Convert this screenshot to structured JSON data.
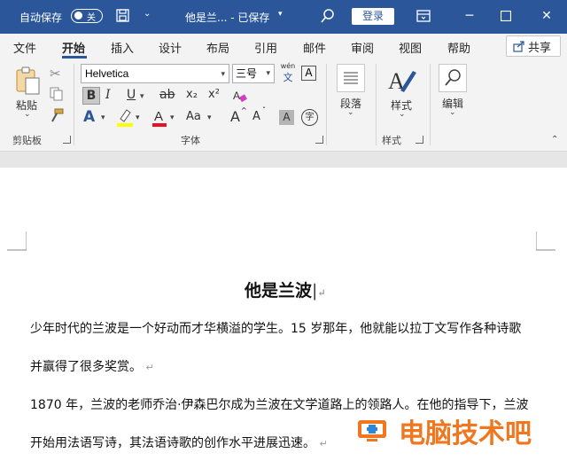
{
  "titlebar": {
    "autosave_label": "自动保存",
    "autosave_state": "关",
    "document_title": "他是兰... - 已保存",
    "login_label": "登录",
    "window_controls": [
      "minimize-icon",
      "restore-icon",
      "close-icon"
    ]
  },
  "tabs": [
    {
      "label": "文件"
    },
    {
      "label": "开始",
      "active": true
    },
    {
      "label": "插入"
    },
    {
      "label": "设计"
    },
    {
      "label": "布局"
    },
    {
      "label": "引用"
    },
    {
      "label": "邮件"
    },
    {
      "label": "审阅"
    },
    {
      "label": "视图"
    },
    {
      "label": "帮助"
    }
  ],
  "share_label": "共享",
  "ribbon": {
    "clipboard": {
      "paste_label": "粘贴",
      "group_label": "剪贴板"
    },
    "font": {
      "font_name": "Helvetica",
      "font_size": "三号",
      "phonetic_top": "wén",
      "phonetic_bottom": "文",
      "bold": "B",
      "italic": "I",
      "underline": "U",
      "strike": "ab",
      "subscript": "x₂",
      "superscript": "x²",
      "grow": "A",
      "shrink": "A",
      "case": "Aa",
      "shade": "A",
      "enclose": "字",
      "group_label": "字体"
    },
    "paragraph": {
      "label": "段落"
    },
    "styles": {
      "label": "样式",
      "group_label": "样式"
    },
    "editing": {
      "label": "编辑"
    }
  },
  "document": {
    "title": "他是兰波",
    "paragraphs": [
      "少年时代的兰波是一个好动而才华横溢的学生。15 岁那年，他就能以拉丁文写作各种诗歌",
      "并赢得了很多奖赏。",
      "1870 年，兰波的老师乔治·伊森巴尔成为兰波在文学道路上的领路人。在他的指导下，兰波",
      "开始用法语写诗，其法语诗歌的创作水平进展迅速。"
    ],
    "paragraph_mark": "↵"
  },
  "watermark": {
    "text": "电脑技术吧"
  },
  "colors": {
    "brand": "#2b579a",
    "highlight": "#ffff00",
    "font_color": "#e81123",
    "watermark": "#f0771f"
  }
}
